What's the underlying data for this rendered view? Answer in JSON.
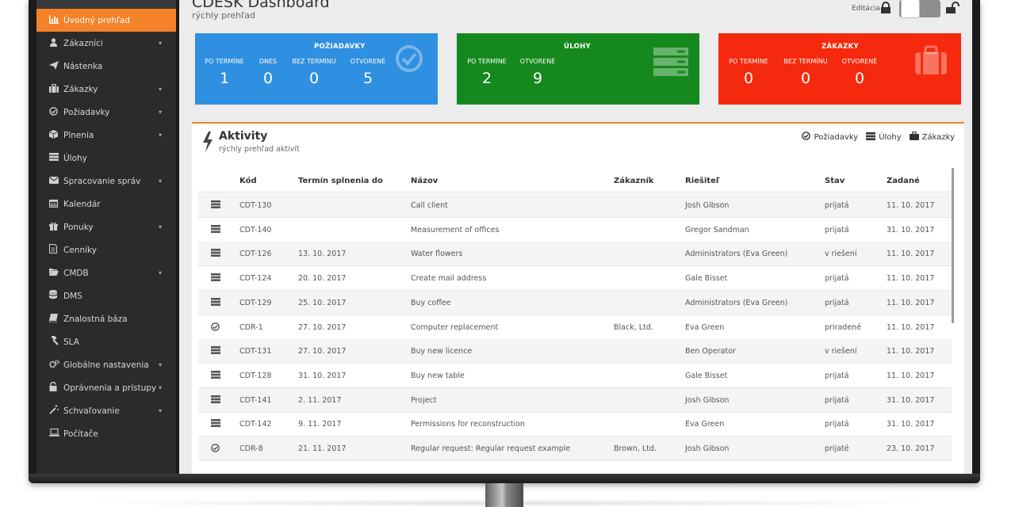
{
  "sidebar": {
    "items": [
      {
        "label": "Úvodný prehľad",
        "icon": "bar-chart-icon",
        "active": true,
        "caret": false
      },
      {
        "label": "Zákazníci",
        "icon": "user-icon",
        "active": false,
        "caret": true
      },
      {
        "label": "Nástenka",
        "icon": "paper-plane-icon",
        "active": false,
        "caret": false
      },
      {
        "label": "Zákazky",
        "icon": "briefcase-icon",
        "active": false,
        "caret": true
      },
      {
        "label": "Požiadavky",
        "icon": "check-circle-icon",
        "active": false,
        "caret": true
      },
      {
        "label": "Plnenia",
        "icon": "box-icon",
        "active": false,
        "caret": true
      },
      {
        "label": "Úlohy",
        "icon": "server-icon",
        "active": false,
        "caret": false
      },
      {
        "label": "Spracovanie správ",
        "icon": "envelope-icon",
        "active": false,
        "caret": true
      },
      {
        "label": "Kalendár",
        "icon": "calendar-icon",
        "active": false,
        "caret": false
      },
      {
        "label": "Ponuky",
        "icon": "gift-icon",
        "active": false,
        "caret": true
      },
      {
        "label": "Cenníky",
        "icon": "document-icon",
        "active": false,
        "caret": false
      },
      {
        "label": "CMDB",
        "icon": "folder-open-icon",
        "active": false,
        "caret": true
      },
      {
        "label": "DMS",
        "icon": "database-icon",
        "active": false,
        "caret": false
      },
      {
        "label": "Znalostná báza",
        "icon": "book-icon",
        "active": false,
        "caret": false
      },
      {
        "label": "SLA",
        "icon": "gavel-icon",
        "active": false,
        "caret": false
      },
      {
        "label": "Globálne nastavenia",
        "icon": "cogs-icon",
        "active": false,
        "caret": true
      },
      {
        "label": "Oprávnenia a prístupy",
        "icon": "unlock-icon",
        "active": false,
        "caret": true
      },
      {
        "label": "Schvaľovanie",
        "icon": "magic-wand-icon",
        "active": false,
        "caret": true
      },
      {
        "label": "Počítače",
        "icon": "laptop-icon",
        "active": false,
        "caret": false
      }
    ]
  },
  "header": {
    "title": "CDESK Dashboard",
    "subtitle": "rýchly prehľad",
    "edit_label": "Editácia"
  },
  "cards": [
    {
      "title": "POŽIADAVKY",
      "color": "#2f8fe0",
      "icon": "check-circle-icon",
      "cols": [
        {
          "label": "PO TERMÍNE",
          "value": "1"
        },
        {
          "label": "DNES",
          "value": "0"
        },
        {
          "label": "BEZ TERMÍNU",
          "value": "0"
        },
        {
          "label": "OTVORENÉ",
          "value": "5"
        }
      ]
    },
    {
      "title": "ÚLOHY",
      "color": "#16891e",
      "icon": "server-icon",
      "cols": [
        {
          "label": "PO TERMÍNE",
          "value": "2"
        },
        {
          "label": "OTVORENÉ",
          "value": "9"
        }
      ]
    },
    {
      "title": "ZÁKAZKY",
      "color": "#f5290d",
      "icon": "briefcase-icon",
      "cols": [
        {
          "label": "PO TERMÍNE",
          "value": "0"
        },
        {
          "label": "BEZ TERMÍNU",
          "value": "0"
        },
        {
          "label": "OTVORENÉ",
          "value": "0"
        }
      ]
    }
  ],
  "activities": {
    "title": "Aktivity",
    "subtitle": "rýchly prehľad aktivít",
    "legend": [
      {
        "label": "Požiadavky",
        "icon": "check-circle-icon"
      },
      {
        "label": "Úlohy",
        "icon": "server-icon"
      },
      {
        "label": "Zákazky",
        "icon": "briefcase-icon"
      }
    ],
    "columns": {
      "code": "Kód",
      "due": "Termín splnenia do",
      "name": "Názov",
      "customer": "Zákazník",
      "resolver": "Riešiteľ",
      "state": "Stav",
      "date": "Zadané"
    },
    "rows": [
      {
        "type": "task",
        "code": "CDT-130",
        "due": "",
        "name": "Call client",
        "customer": "",
        "resolver": "Josh Gibson",
        "state": "prijatá",
        "date": "11. 10. 2017"
      },
      {
        "type": "task",
        "code": "CDT-140",
        "due": "",
        "name": "Measurement of offices",
        "customer": "",
        "resolver": "Gregor Sandman",
        "state": "prijatá",
        "date": "31. 10. 2017"
      },
      {
        "type": "task",
        "code": "CDT-126",
        "due": "13. 10. 2017",
        "name": "Water flowers",
        "customer": "",
        "resolver": "Administrators (Eva Green)",
        "state": "v riešení",
        "date": "11. 10. 2017"
      },
      {
        "type": "task",
        "code": "CDT-124",
        "due": "20. 10. 2017",
        "name": "Create mail address",
        "customer": "",
        "resolver": "Gale Bisset",
        "state": "prijatá",
        "date": "11. 10. 2017"
      },
      {
        "type": "task",
        "code": "CDT-129",
        "due": "25. 10. 2017",
        "name": "Buy coffee",
        "customer": "",
        "resolver": "Administrators (Eva Green)",
        "state": "prijatá",
        "date": "11. 10. 2017"
      },
      {
        "type": "request",
        "code": "CDR-1",
        "due": "27. 10. 2017",
        "name": "Computer replacement",
        "customer": "Black, Ltd.",
        "resolver": "Eva Green",
        "state": "priradené",
        "date": "11. 10. 2017"
      },
      {
        "type": "task",
        "code": "CDT-131",
        "due": "27. 10. 2017",
        "name": "Buy new licence",
        "customer": "",
        "resolver": "Ben Operator",
        "state": "v riešení",
        "date": "11. 10. 2017"
      },
      {
        "type": "task",
        "code": "CDT-128",
        "due": "31. 10. 2017",
        "name": "Buy new table",
        "customer": "",
        "resolver": "Gale Bisset",
        "state": "prijatá",
        "date": "11. 10. 2017"
      },
      {
        "type": "task",
        "code": "CDT-141",
        "due": "2. 11. 2017",
        "name": "Project",
        "customer": "",
        "resolver": "Josh Gibson",
        "state": "prijatá",
        "date": "31. 10. 2017"
      },
      {
        "type": "task",
        "code": "CDT-142",
        "due": "9. 11. 2017",
        "name": "Permissions for reconstruction",
        "customer": "",
        "resolver": "Eva Green",
        "state": "prijatá",
        "date": "31. 10. 2017"
      },
      {
        "type": "request",
        "code": "CDR-8",
        "due": "21. 11. 2017",
        "name": "Regular request: Regular request example",
        "customer": "Brown, Ltd.",
        "resolver": "Josh Gibson",
        "state": "prijaté",
        "date": "23. 10. 2017"
      }
    ]
  },
  "colors": {
    "accent": "#f4822a",
    "sidebar": "#2b2b2b",
    "blue": "#2f8fe0",
    "green": "#16891e",
    "red": "#f5290d"
  }
}
